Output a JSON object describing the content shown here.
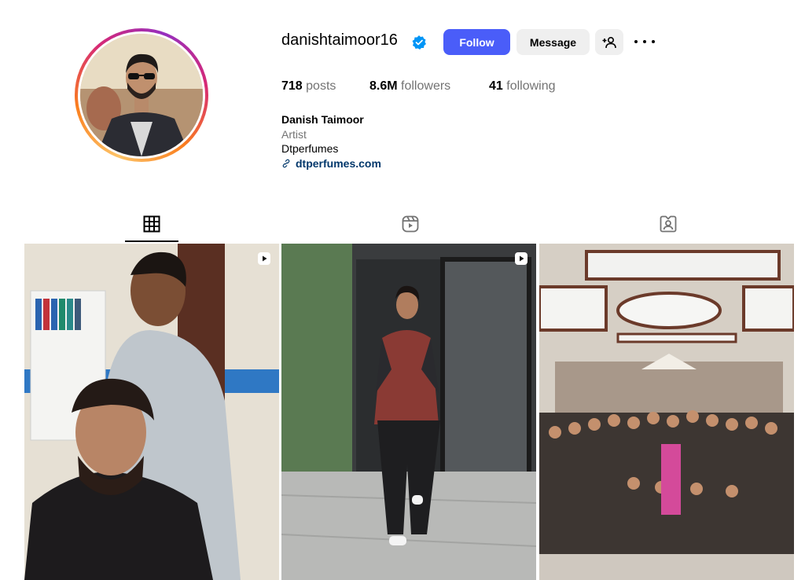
{
  "profile": {
    "username": "danishtaimoor16",
    "verified": true,
    "full_name": "Danish Taimoor",
    "category": "Artist",
    "bio": "Dtperfumes",
    "website": "dtperfumes.com"
  },
  "actions": {
    "follow_label": "Follow",
    "message_label": "Message",
    "add_user_icon": "add-user-icon",
    "more_icon": "more-options-icon"
  },
  "stats": {
    "posts_value": "718",
    "posts_label": "posts",
    "followers_value": "8.6M",
    "followers_label": "followers",
    "following_value": "41",
    "following_label": "following"
  },
  "tabs": [
    {
      "icon": "grid-icon",
      "active": true
    },
    {
      "icon": "reels-icon",
      "active": false
    },
    {
      "icon": "tagged-icon",
      "active": false
    }
  ],
  "posts": [
    {
      "type": "reel",
      "icon": "reel-badge-icon"
    },
    {
      "type": "reel",
      "icon": "reel-badge-icon"
    },
    {
      "type": "photo"
    }
  ],
  "colors": {
    "accent": "#4a5df9",
    "verified": "#0095f6",
    "link": "#00376b",
    "secondary_text": "#737373",
    "button_bg": "#efefef"
  }
}
